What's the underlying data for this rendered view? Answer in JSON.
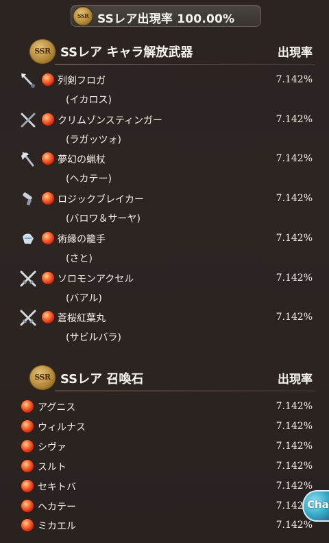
{
  "header": {
    "badge_text": "SSR",
    "title": "SSレア出現率 100.00%"
  },
  "sections": {
    "weapons": {
      "badge_text": "SSR",
      "title": "SSレア キャラ解放武器",
      "rate_heading": "出現率",
      "items": [
        {
          "name": "列剣フロガ",
          "character": "(イカロス)",
          "rate": "7.142%",
          "icon": "spear-icon"
        },
        {
          "name": "クリムゾンスティンガー",
          "character": "(ラガッツォ)",
          "rate": "7.142%",
          "icon": "crossed-blades-icon"
        },
        {
          "name": "夢幻の蝋杖",
          "character": "(ヘカテー)",
          "rate": "7.142%",
          "icon": "axe-icon"
        },
        {
          "name": "ロジックブレイカー",
          "character": "(バロワ＆サーヤ)",
          "rate": "7.142%",
          "icon": "gun-icon"
        },
        {
          "name": "術縁の籠手",
          "character": "(さと)",
          "rate": "7.142%",
          "icon": "gauntlet-icon"
        },
        {
          "name": "ソロモンアクセル",
          "character": "(バアル)",
          "rate": "7.142%",
          "icon": "crossed-swords-icon"
        },
        {
          "name": "蒼桜紅葉丸",
          "character": "(サビルバラ)",
          "rate": "7.142%",
          "icon": "crossed-swords-icon"
        }
      ]
    },
    "summons": {
      "badge_text": "SSR",
      "title": "SSレア 召喚石",
      "rate_heading": "出現率",
      "items": [
        {
          "name": "アグニス",
          "rate": "7.142%"
        },
        {
          "name": "ウィルナス",
          "rate": "7.142%"
        },
        {
          "name": "シヴァ",
          "rate": "7.142%"
        },
        {
          "name": "スルト",
          "rate": "7.142%"
        },
        {
          "name": "セキトバ",
          "rate": "7.142%"
        },
        {
          "name": "ヘカテー",
          "rate": "7.142%"
        },
        {
          "name": "ミカエル",
          "rate": "7.142%"
        }
      ]
    }
  },
  "chat": {
    "label": "Chat",
    "icon": "chat-bubble-icon"
  },
  "colors": {
    "background": "#2b2421",
    "fire_orb": "#e0401c",
    "text": "#f3efe9",
    "badge_gold": "#c9a14e",
    "chat_blue": "#3aaed0"
  }
}
